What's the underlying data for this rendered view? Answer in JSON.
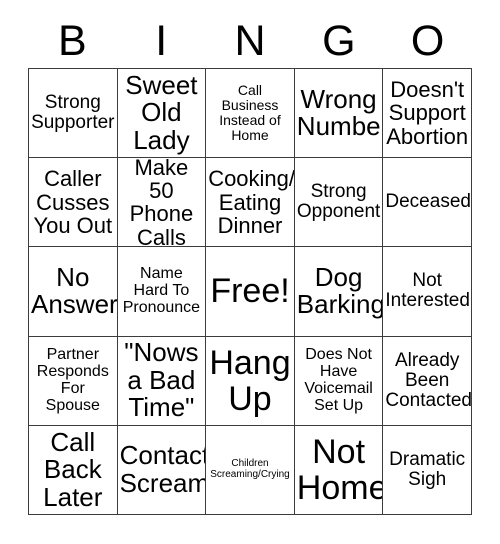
{
  "card": {
    "headers": [
      "B",
      "I",
      "N",
      "G",
      "O"
    ],
    "colors": {
      "background": "#ffffff",
      "text": "#000000",
      "grid_line": "#3c3c3c"
    },
    "cells": [
      {
        "text": "Strong\nSupporter",
        "size": "m"
      },
      {
        "text": "Sweet\nOld\nLady",
        "size": "xl"
      },
      {
        "text": "Call\nBusiness\nInstead of\nHome",
        "size": "xs"
      },
      {
        "text": "Wrong\nNumber",
        "size": "xl"
      },
      {
        "text": "Doesn't\nSupport\nAbortion",
        "size": "l"
      },
      {
        "text": "Caller\nCusses\nYou Out",
        "size": "l"
      },
      {
        "text": "Make 50\nPhone\nCalls",
        "size": "l"
      },
      {
        "text": "Cooking/\nEating\nDinner",
        "size": "l"
      },
      {
        "text": "Strong\nOpponent",
        "size": "m"
      },
      {
        "text": "Deceased",
        "size": "m"
      },
      {
        "text": "No\nAnswer",
        "size": "xl"
      },
      {
        "text": "Name\nHard To\nPronounce",
        "size": "s"
      },
      {
        "text": "Free!",
        "size": "xxl"
      },
      {
        "text": "Dog\nBarking",
        "size": "xl"
      },
      {
        "text": "Not\nInterested",
        "size": "m"
      },
      {
        "text": "Partner\nResponds\nFor\nSpouse",
        "size": "s"
      },
      {
        "text": "\"Nows\na Bad\nTime\"",
        "size": "xl"
      },
      {
        "text": "Hang\nUp",
        "size": "xxl"
      },
      {
        "text": "Does Not\nHave\nVoicemail\nSet Up",
        "size": "s"
      },
      {
        "text": "Already\nBeen\nContacted",
        "size": "m"
      },
      {
        "text": "Call\nBack\nLater",
        "size": "xl"
      },
      {
        "text": "Contact\nScreams",
        "size": "xl"
      },
      {
        "text": "Children\nScreaming/Crying",
        "size": "xxs"
      },
      {
        "text": "Not\nHome",
        "size": "xxl"
      },
      {
        "text": "Dramatic\nSigh",
        "size": "m"
      }
    ]
  }
}
